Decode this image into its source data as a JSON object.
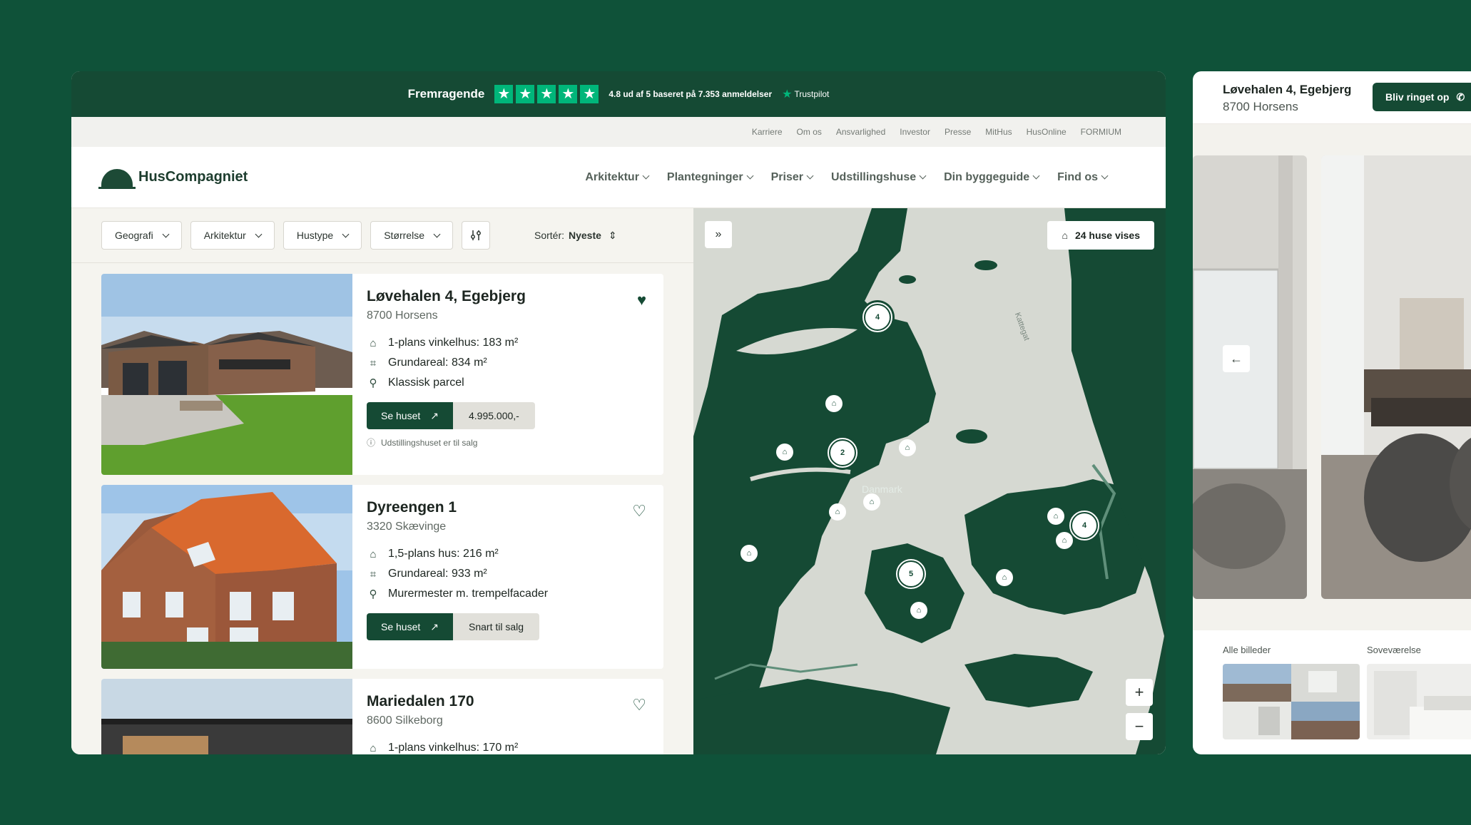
{
  "trustbar": {
    "title": "Fremragende",
    "stars": [
      "★",
      "★",
      "★",
      "★",
      "★"
    ],
    "score_text": "4.8 ud af 5 baseret på 7.353 anmeldelser",
    "brand": "Trustpilot"
  },
  "utility_links": [
    "Karriere",
    "Om os",
    "Ansvarlighed",
    "Investor",
    "Presse",
    "MitHus",
    "HusOnline",
    "FORMIUM"
  ],
  "logo": "HusCompagniet",
  "menu": [
    "Arkitektur",
    "Plantegninger",
    "Priser",
    "Udstillingshuse",
    "Din byggeguide",
    "Find os"
  ],
  "filters": [
    "Geografi",
    "Arkitektur",
    "Hustype",
    "Størrelse"
  ],
  "sort": {
    "label": "Sortér:",
    "value": "Nyeste"
  },
  "listings": [
    {
      "title": "Løvehalen 4, Egebjerg",
      "address": "8700 Horsens",
      "features": [
        "1-plans vinkelhus: 183 m²",
        "Grundareal: 834 m²",
        "Klassisk parcel"
      ],
      "see_label": "Se huset",
      "price": "4.995.000,-",
      "note": "Udstillingshuset er til salg",
      "favorited": true
    },
    {
      "title": "Dyreengen 1",
      "address": "3320 Skævinge",
      "features": [
        "1,5-plans hus: 216 m²",
        "Grundareal: 933 m²",
        "Murermester m. trempelfacader"
      ],
      "see_label": "Se huset",
      "price": "Snart til salg",
      "favorited": false
    },
    {
      "title": "Mariedalen 170",
      "address": "8600 Silkeborg",
      "features": [
        "1-plans vinkelhus: 170 m²"
      ],
      "favorited": false
    }
  ],
  "map": {
    "count_label": "24 huse vises",
    "country_label": "Danmark",
    "sea_label": "Kattegat",
    "clusters": [
      "4",
      "2",
      "5",
      "4"
    ]
  },
  "panel": {
    "title": "Løvehalen 4, Egebjerg",
    "subtitle": "8700 Horsens",
    "call_label": "Bliv ringet op",
    "thumb_labels": [
      "Alle billeder",
      "Soveværelse"
    ]
  },
  "colors": {
    "brand": "#154a34",
    "background": "#0f5239",
    "trustpilot": "#00b67a"
  }
}
